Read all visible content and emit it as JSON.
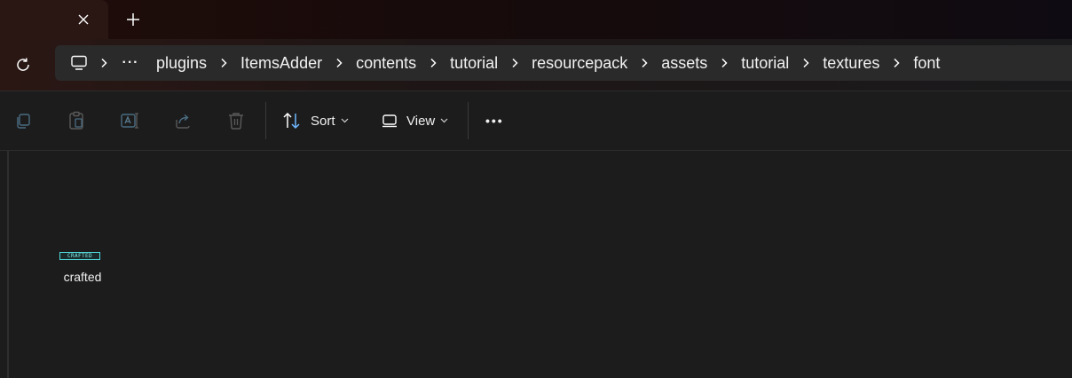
{
  "tabs": {
    "close_icon": "close-icon",
    "new_tab_icon": "plus-icon"
  },
  "address": {
    "refresh_icon": "refresh-icon",
    "computer_icon": "computer-icon",
    "overflow_label": "···",
    "path": [
      "plugins",
      "ItemsAdder",
      "contents",
      "tutorial",
      "resourcepack",
      "assets",
      "tutorial",
      "textures",
      "font"
    ]
  },
  "toolbar": {
    "icons": [
      "copy-icon",
      "paste-icon",
      "rename-icon",
      "share-icon",
      "delete-icon"
    ],
    "sort_label": "Sort",
    "view_label": "View",
    "more_label": "•••"
  },
  "files": [
    {
      "name": "crafted",
      "thumbnail_text": "CRAFTED",
      "accent": "#4fd6d6"
    }
  ]
}
